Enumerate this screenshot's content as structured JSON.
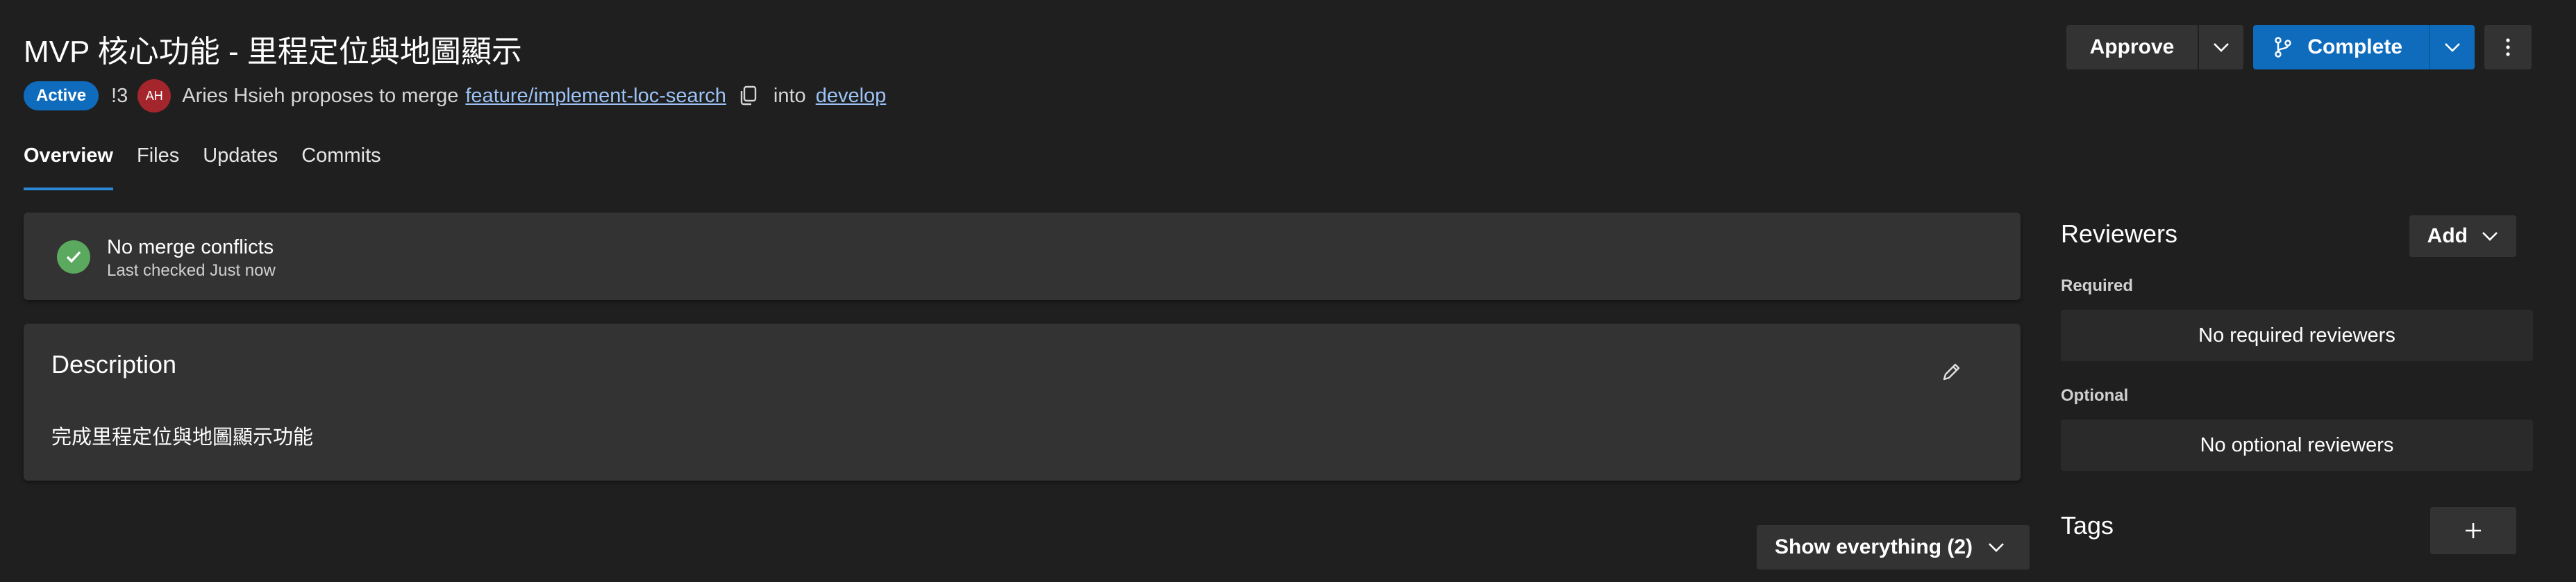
{
  "pr": {
    "title": "MVP 核心功能 - 里程定位與地圖顯示",
    "status": "Active",
    "id": "!3",
    "author_initials": "AH",
    "author_text": "Aries Hsieh proposes to merge",
    "source_branch": "feature/implement-loc-search",
    "into_text": "into",
    "target_branch": "develop"
  },
  "actions": {
    "approve_label": "Approve",
    "complete_label": "Complete"
  },
  "tabs": [
    {
      "label": "Overview",
      "active": true
    },
    {
      "label": "Files",
      "active": false
    },
    {
      "label": "Updates",
      "active": false
    },
    {
      "label": "Commits",
      "active": false
    }
  ],
  "merge_status": {
    "title": "No merge conflicts",
    "subtitle": "Last checked Just now"
  },
  "description": {
    "title": "Description",
    "body": "完成里程定位與地圖顯示功能"
  },
  "filter": {
    "show_label": "Show everything (2)"
  },
  "reviewers": {
    "title": "Reviewers",
    "add_label": "Add",
    "required_label": "Required",
    "required_empty": "No required reviewers",
    "optional_label": "Optional",
    "optional_empty": "No optional reviewers"
  },
  "tags": {
    "title": "Tags"
  },
  "icons": {
    "copy": "copy-icon",
    "edit": "pencil-icon",
    "check": "check-circle-icon",
    "branch": "branch-icon",
    "more": "more-vertical-icon",
    "chevron": "chevron-down-icon",
    "plus": "plus-icon"
  },
  "colors": {
    "background": "#1f1f1f",
    "card": "#333333",
    "accent": "#0f6cbd",
    "link": "#9cc3f5",
    "success": "#5ba95e",
    "avatar": "#a4262c"
  }
}
